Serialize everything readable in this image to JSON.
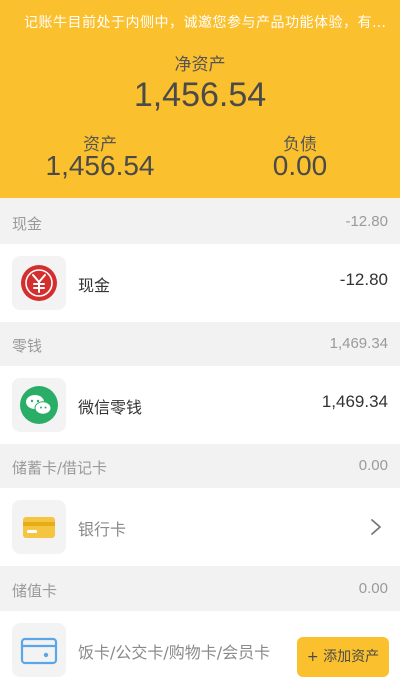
{
  "banner": {
    "text": "记账牛目前处于内侧中，诚邀您参与产品功能体验，有…"
  },
  "summary": {
    "net_label": "净资产",
    "net_value": "1,456.54",
    "assets_label": "资产",
    "assets_value": "1,456.54",
    "liabilities_label": "负债",
    "liabilities_value": "0.00"
  },
  "sections": [
    {
      "title": "现金",
      "total": "-12.80"
    },
    {
      "title": "零钱",
      "total": "1,469.34"
    },
    {
      "title": "储蓄卡/借记卡",
      "total": "0.00"
    },
    {
      "title": "储值卡",
      "total": "0.00"
    }
  ],
  "rows": [
    {
      "name": "现金",
      "value": "-12.80",
      "icon": "yuan-coin-icon"
    },
    {
      "name": "微信零钱",
      "value": "1,469.34",
      "icon": "wechat-icon"
    },
    {
      "name": "银行卡",
      "icon": "bank-card-icon",
      "action": "chevron-right-icon"
    },
    {
      "name": "饭卡/公交卡/购物卡/会员卡",
      "icon": "stored-value-card-icon"
    }
  ],
  "add_button": {
    "label": "+ 添加资产"
  },
  "colors": {
    "accent": "#fbc02d",
    "wechat": "#2aae67",
    "cash": "#d32f2f",
    "card": "#f5c542",
    "stored_card": "#5aa6e6"
  }
}
